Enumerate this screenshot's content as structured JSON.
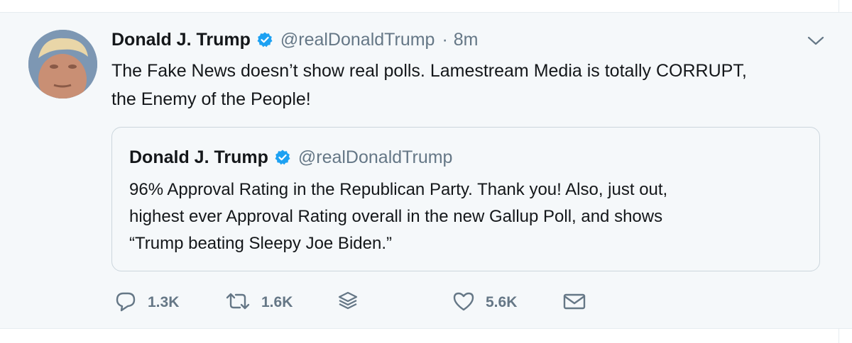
{
  "tweet": {
    "author_name": "Donald J. Trump",
    "author_handle": "@realDonaldTrump",
    "separator": "·",
    "timestamp": "8m",
    "text_line1": "The Fake News doesn’t show real polls. Lamestream Media is totally CORRUPT,",
    "text_line2": "the Enemy of the People!"
  },
  "quoted_tweet": {
    "author_name": "Donald J. Trump",
    "author_handle": "@realDonaldTrump",
    "text_line1": "96% Approval Rating in the Republican Party. Thank you! Also, just out,",
    "text_line2": "highest ever Approval Rating overall in the new Gallup Poll, and shows",
    "text_line3": "“Trump beating Sleepy Joe Biden.”"
  },
  "actions": {
    "reply_count": "1.3K",
    "retweet_count": "1.6K",
    "like_count": "5.6K"
  },
  "icons": {
    "verified": "verified-badge-icon",
    "caret": "chevron-down-icon",
    "reply": "reply-icon",
    "retweet": "retweet-icon",
    "stack": "stack-icon",
    "like": "heart-icon",
    "dm": "envelope-icon"
  },
  "colors": {
    "background": "#f5f8fa",
    "text": "#14171a",
    "secondary": "#657786",
    "verified": "#1da1f2",
    "border": "#ccd6dd"
  }
}
